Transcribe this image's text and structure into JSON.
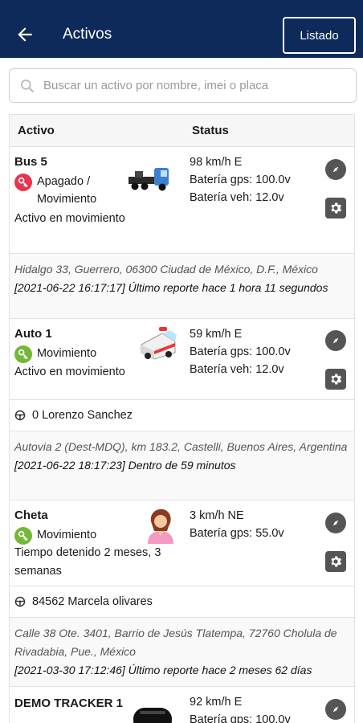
{
  "header": {
    "title": "Activos",
    "listado_label": "Listado"
  },
  "search": {
    "placeholder": "Buscar un activo por nombre, imei o placa"
  },
  "table": {
    "col_asset": "Activo",
    "col_status": "Status"
  },
  "assets": [
    {
      "name": "Bus 5",
      "state": "Apagado / Movimiento",
      "state_color": "#e8344e",
      "description": "Activo en movimiento",
      "icon": "truck-icon",
      "speed": "98 km/h E",
      "gps_battery": "Batería gps: 100.0v",
      "vehicle_battery": "Batería veh: 12.0v",
      "address": "Hidalgo 33, Guerrero, 06300 Ciudad de México, D.F., México",
      "report": "[2021-06-22 16:17:17] Último reporte hace 1 hora 11 segundos"
    },
    {
      "name": "Auto 1",
      "state": "Movimiento",
      "state_color": "#73b836",
      "description": "Activo en movimiento",
      "icon": "ambulance-icon",
      "speed": "59 km/h E",
      "gps_battery": "Batería gps: 100.0v",
      "vehicle_battery": "Batería veh: 12.0v",
      "driver": "0 Lorenzo Sanchez",
      "address": "Autovia 2 (Dest-MDQ), km 183.2, Castelli, Buenos Aires, Argentina",
      "report": "[2021-06-22 18:17:23] Dentro de 59 minutos"
    },
    {
      "name": "Cheta",
      "state": "Movimiento",
      "state_color": "#73b836",
      "description": "Tiempo detenido 2 meses, 3 semanas",
      "icon": "person-icon",
      "speed": "3 km/h NE",
      "gps_battery": "Batería gps: 55.0v",
      "driver": "84562 Marcela olivares",
      "address": "Calle 38 Ote. 3401, Barrio de Jesús Tlatempa, 72760 Cholula de Rivadabia, Pue., México",
      "report": "[2021-03-30 17:12:46] Último reporte hace 2 meses 62 días"
    },
    {
      "name": "DEMO TRACKER 1",
      "icon": "tracker-device-icon",
      "speed": "92 km/h E",
      "gps_battery": "Batería gps: 100.0v"
    }
  ]
}
